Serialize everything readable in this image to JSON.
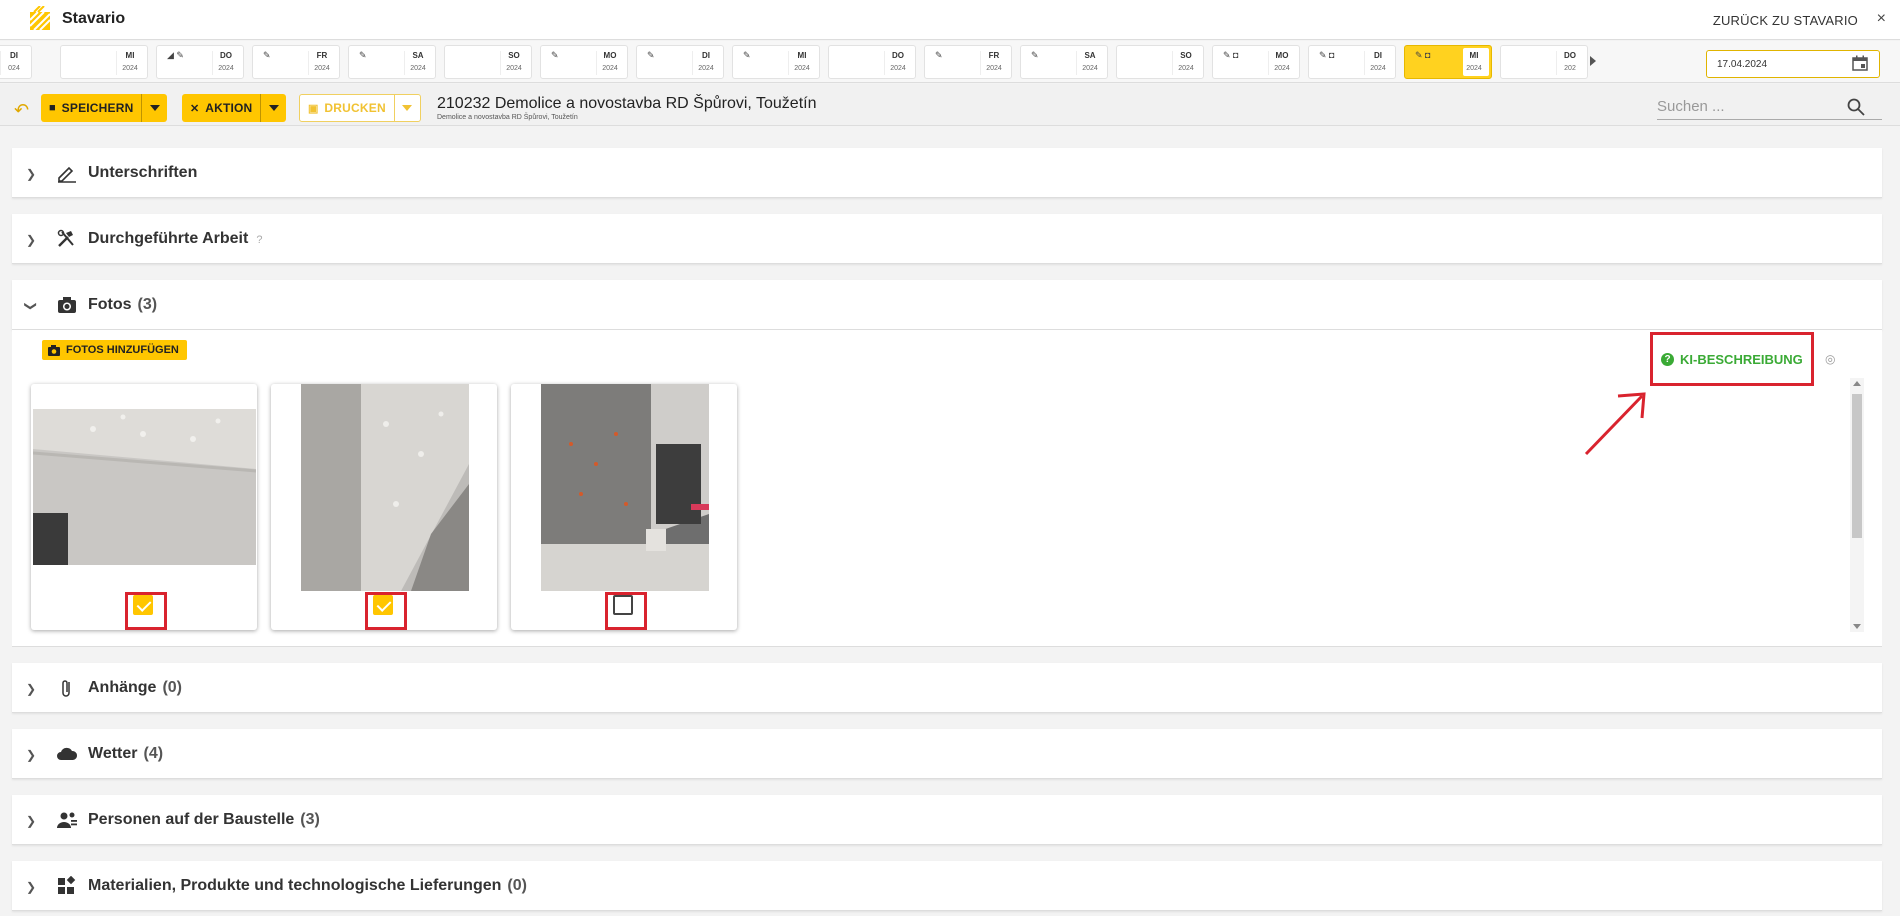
{
  "app": {
    "name": "Stavario",
    "back_label": "ZURÜCK ZU STAVARIO",
    "close": "×"
  },
  "date_strip": {
    "days": [
      {
        "name": "DI",
        "year": "024",
        "icon": ""
      },
      {
        "name": "MI",
        "year": "2024",
        "icon": ""
      },
      {
        "name": "DO",
        "year": "2024",
        "icon": "◢ ✎"
      },
      {
        "name": "FR",
        "year": "2024",
        "icon": "✎"
      },
      {
        "name": "SA",
        "year": "2024",
        "icon": "✎"
      },
      {
        "name": "SO",
        "year": "2024",
        "icon": ""
      },
      {
        "name": "MO",
        "year": "2024",
        "icon": "✎"
      },
      {
        "name": "DI",
        "year": "2024",
        "icon": "✎"
      },
      {
        "name": "MI",
        "year": "2024",
        "icon": "✎"
      },
      {
        "name": "DO",
        "year": "2024",
        "icon": ""
      },
      {
        "name": "FR",
        "year": "2024",
        "icon": "✎"
      },
      {
        "name": "SA",
        "year": "2024",
        "icon": "✎"
      },
      {
        "name": "SO",
        "year": "2024",
        "icon": ""
      },
      {
        "name": "MO",
        "year": "2024",
        "icon": "✎ ◘"
      },
      {
        "name": "DI",
        "year": "2024",
        "icon": "✎ ◘"
      },
      {
        "name": "MI",
        "year": "2024",
        "icon": "✎ ◘",
        "active": true
      },
      {
        "name": "DO",
        "year": "202",
        "icon": ""
      }
    ],
    "selected_date": "17.04.2024"
  },
  "toolbar": {
    "save_label": "SPEICHERN",
    "action_label": "AKTION",
    "print_label": "DRUCKEN",
    "project_title": "210232 Demolice a novostavba RD Špůrovi, Toužetín",
    "project_subtitle": "Demolice a novostavba RD Špůrovi, Toužetín",
    "search_placeholder": "Suchen ..."
  },
  "panels": {
    "signatures": {
      "title": "Unterschriften",
      "count": ""
    },
    "work": {
      "title": "Durchgeführte Arbeit",
      "help": "?"
    },
    "photos": {
      "title": "Fotos",
      "count": "(3)"
    },
    "attachments": {
      "title": "Anhänge",
      "count": "(0)"
    },
    "weather": {
      "title": "Wetter",
      "count": "(4)"
    },
    "persons": {
      "title": "Personen auf der Baustelle",
      "count": "(3)"
    },
    "materials": {
      "title": "Materialien, Produkte und technologische Lieferungen",
      "count": "(0)"
    }
  },
  "photos": {
    "add_label": "FOTOS HINZUFÜGEN",
    "ki_label": "KI-BESCHREIBUNG",
    "items": [
      {
        "checked": true
      },
      {
        "checked": true
      },
      {
        "checked": false
      }
    ]
  },
  "colors": {
    "accent": "#ffc600",
    "ki_green": "#3aaa35",
    "highlight_red": "#d9232e"
  }
}
